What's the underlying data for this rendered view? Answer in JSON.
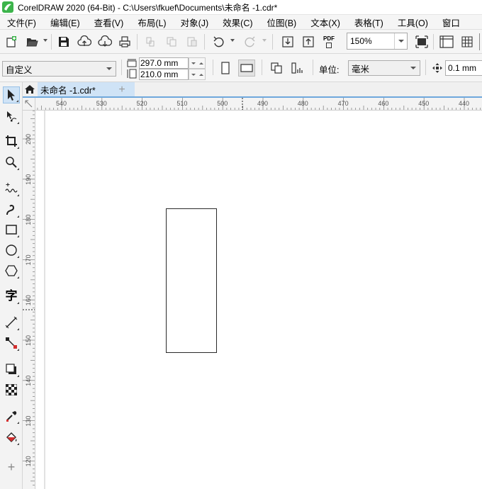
{
  "window": {
    "title": "CorelDRAW 2020 (64-Bit) - C:\\Users\\fkuef\\Documents\\未命名 -1.cdr*"
  },
  "menu": [
    {
      "label": "文件(F)"
    },
    {
      "label": "编辑(E)"
    },
    {
      "label": "查看(V)"
    },
    {
      "label": "布局(L)"
    },
    {
      "label": "对象(J)"
    },
    {
      "label": "效果(C)"
    },
    {
      "label": "位图(B)"
    },
    {
      "label": "文本(X)"
    },
    {
      "label": "表格(T)"
    },
    {
      "label": "工具(O)"
    },
    {
      "label": "窗口"
    }
  ],
  "toolbar": {
    "zoom_level": "150%",
    "pdf_label": "PDF"
  },
  "property_bar": {
    "page_preset": "自定义",
    "page_width": "297.0 mm",
    "page_height": "210.0 mm",
    "units_label": "单位:",
    "units_value": "毫米",
    "nudge_distance": "0.1 mm"
  },
  "document_tabs": [
    {
      "label": "未命名 -1.cdr*",
      "active": true
    }
  ],
  "ruler": {
    "horizontal_ticks": [
      "540",
      "530",
      "520",
      "510",
      "500",
      "490",
      "480",
      "470",
      "460",
      "450",
      "440"
    ],
    "vertical_ticks": [
      "200",
      "190",
      "180",
      "170",
      "160",
      "150",
      "140",
      "130",
      "120"
    ]
  },
  "colors": {
    "accent": "#6fa8dc",
    "tab_active": "#cfe3f6",
    "logo_green": "#3cb44b"
  }
}
